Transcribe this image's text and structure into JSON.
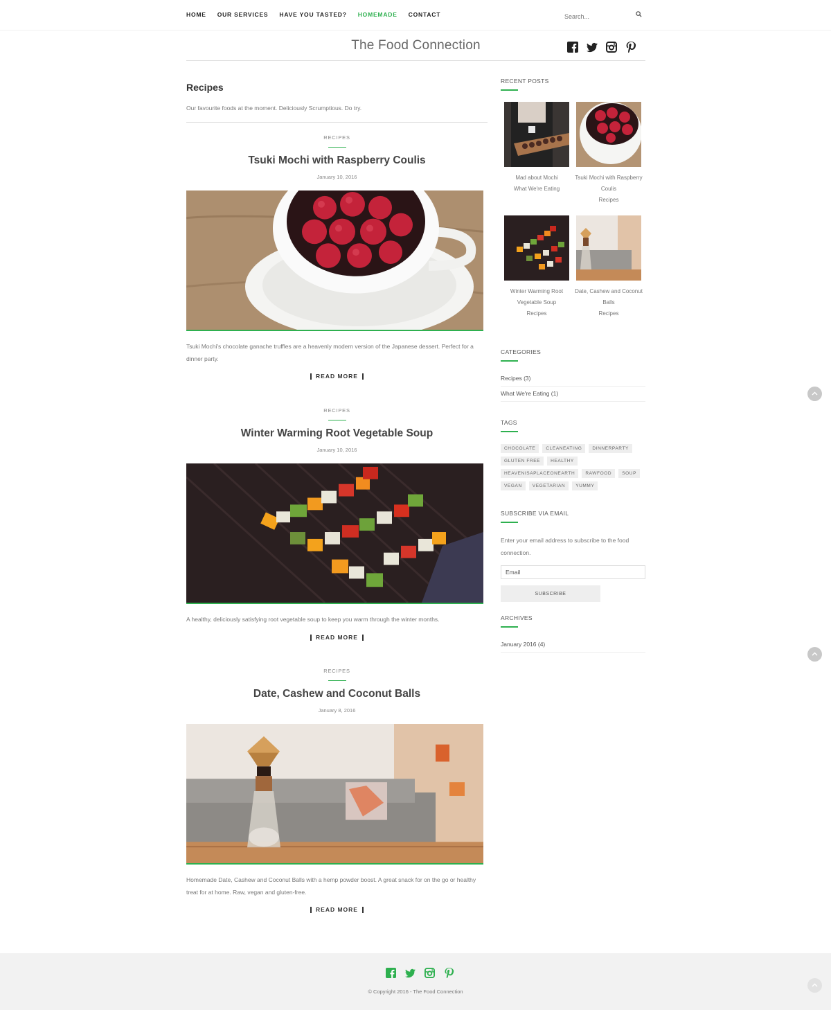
{
  "nav": {
    "items": [
      "HOME",
      "OUR SERVICES",
      "HAVE YOU TASTED?",
      "HOMEMADE",
      "CONTACT"
    ],
    "active": "HOMEMADE",
    "search_placeholder": "Search..."
  },
  "header": {
    "site_title": "The Food Connection"
  },
  "social": [
    "facebook-icon",
    "twitter-icon",
    "instagram-icon",
    "pinterest-icon"
  ],
  "page": {
    "title": "Recipes",
    "description": "Our favourite foods at the moment. Deliciously Scrumptious. Do try."
  },
  "posts": [
    {
      "category": "RECIPES",
      "title": "Tsuki Mochi with Raspberry Coulis",
      "date": "January 10, 2016",
      "excerpt": "Tsuki Mochi's chocolate ganache truffles are a heavenly modern version of the Japanese dessert. Perfect for a dinner party.",
      "read_more": "READ MORE",
      "image": "raspberries-in-cup"
    },
    {
      "category": "RECIPES",
      "title": "Winter Warming Root Vegetable Soup",
      "date": "January 10, 2016",
      "excerpt": "A healthy, deliciously satisfying root vegetable soup to keep you warm through the winter months.",
      "read_more": "READ MORE",
      "image": "vegetable-skewers"
    },
    {
      "category": "RECIPES",
      "title": "Date, Cashew and Coconut Balls",
      "date": "January 8, 2016",
      "excerpt": "Homemade Date, Cashew and Coconut Balls with a hemp powder boost. A great snack for on the go or healthy treat for at home. Raw, vegan and gluten-free.",
      "read_more": "READ MORE",
      "image": "coffee-chemex"
    }
  ],
  "sidebar": {
    "recent_posts": {
      "title": "RECENT POSTS",
      "items": [
        {
          "title": "Mad about Mochi",
          "category": "What We're Eating"
        },
        {
          "title": "Tsuki Mochi with Raspberry Coulis",
          "category": "Recipes"
        },
        {
          "title": "Winter Warming Root Vegetable Soup",
          "category": "Recipes"
        },
        {
          "title": "Date, Cashew and Coconut Balls",
          "category": "Recipes"
        }
      ]
    },
    "categories": {
      "title": "CATEGORIES",
      "items": [
        "Recipes (3)",
        "What We're Eating (1)"
      ]
    },
    "tags": {
      "title": "TAGS",
      "items": [
        "CHOCOLATE",
        "CLEANEATING",
        "DINNERPARTY",
        "GLUTEN FREE",
        "HEALTHY",
        "HEAVENISAPLACEONEARTH",
        "RAWFOOD",
        "SOUP",
        "VEGAN",
        "VEGETARIAN",
        "YUMMY"
      ]
    },
    "subscribe": {
      "title": "SUBSCRIBE VIA EMAIL",
      "text": "Enter your email address to subscribe to the food connection.",
      "placeholder": "Email",
      "button": "SUBSCRIBE"
    },
    "archives": {
      "title": "ARCHIVES",
      "items": [
        "January 2016 (4)"
      ]
    }
  },
  "footer": {
    "copyright": "© Copyright 2016 - The Food Connection"
  },
  "colors": {
    "accent": "#2eb04f",
    "footer_bg": "#f2f2f2"
  }
}
